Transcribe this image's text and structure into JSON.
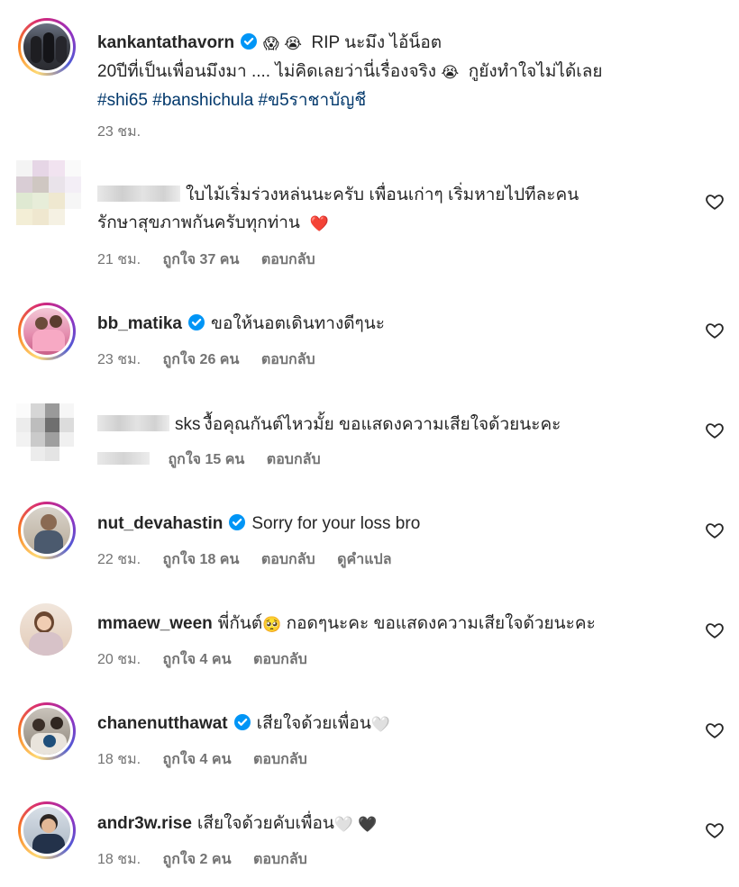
{
  "colors": {
    "username": "#262626",
    "meta": "#737373",
    "hashtag": "#00376b",
    "verified": "#0095f6",
    "red_heart": "#e0245e"
  },
  "post": {
    "username": "kankantathavorn",
    "emoji_1": "😱",
    "emoji_2": "😭",
    "line1": "RIP นะมึง ไอ้น็อต",
    "line2_a": "20ปีที่เป็นเพื่อนมึงมา .... ไม่คิดเลยว่านี่เรื่องจริง",
    "line2_b": "กูยังทำใจไม่ได้เลย",
    "hashtags": [
      "#shi65",
      "#banshichula",
      "#ข5ราชาบัญชี"
    ],
    "time": "23 ชม."
  },
  "comments": [
    {
      "username": "",
      "text_1": "ใบไม้เริ่มร่วงหล่นนะครับ เพื่อนเก่าๆ เริ่มหายไปทีละคน",
      "text_2": "รักษาสุขภาพกันครับทุกท่าน",
      "heart": "❤️",
      "time": "21 ชม.",
      "likes": "ถูกใจ 37 คน",
      "reply": "ตอบกลับ"
    },
    {
      "username": "bb_matika",
      "text": "ขอให้นอตเดินทางดีๆนะ",
      "time": "23 ชม.",
      "likes": "ถูกใจ 26 คน",
      "reply": "ตอบกลับ"
    },
    {
      "username_suffix": "sks",
      "text": "งื้อคุณกันต์ไหวมั้ย ขอแสดงความเสียใจด้วยนะคะ",
      "likes": "ถูกใจ 15 คน",
      "reply": "ตอบกลับ"
    },
    {
      "username": "nut_devahastin",
      "text": "Sorry for your loss bro",
      "time": "22 ชม.",
      "likes": "ถูกใจ 18 คน",
      "reply": "ตอบกลับ",
      "translate": "ดูคำแปล"
    },
    {
      "username": "mmaew_ween",
      "text_a": "พี่กันต์",
      "emoji": "🥺",
      "text_b": "กอดๆนะคะ ขอแสดงความเสียใจด้วยนะคะ",
      "time": "20 ชม.",
      "likes": "ถูกใจ 4 คน",
      "reply": "ตอบกลับ"
    },
    {
      "username": "chanenutthawat",
      "text": "เสียใจด้วยเพื่อน",
      "heart": "🤍",
      "time": "18 ชม.",
      "likes": "ถูกใจ 4 คน",
      "reply": "ตอบกลับ"
    },
    {
      "username": "andr3w.rise",
      "text": "เสียใจด้วยคับเพื่อน",
      "heart_1": "🤍",
      "heart_2": "🖤",
      "time": "18 ชม.",
      "likes": "ถูกใจ 2 คน",
      "reply": "ตอบกลับ"
    }
  ]
}
